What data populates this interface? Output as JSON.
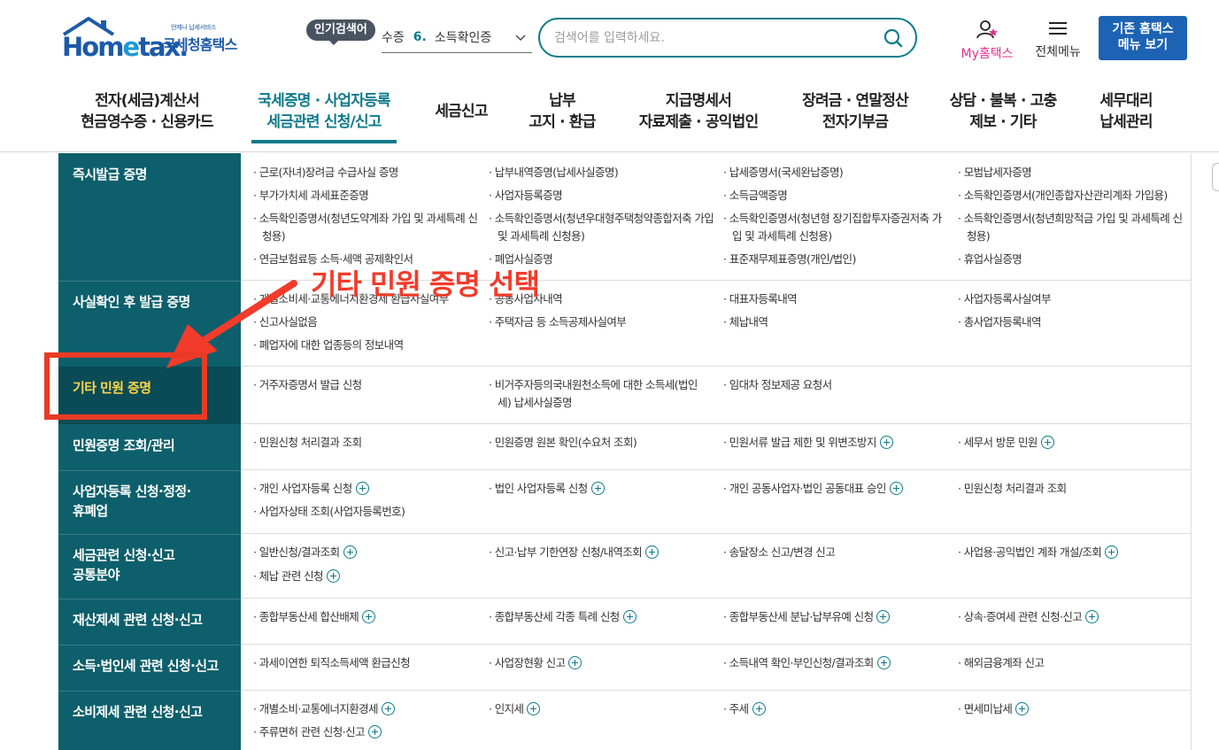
{
  "header": {
    "logo": {
      "sub": "언제나 납세서비스",
      "brand_a": "Hom",
      "brand_e": "e",
      "brand_b": "tax.",
      "name": "국세청홈택스"
    },
    "popular": {
      "badge": "인기검색어",
      "word1": "수증",
      "rank": "6.",
      "word2": "소득확인증"
    },
    "search": {
      "placeholder": "검색어를 입력하세요."
    },
    "my_label": "My홈택스",
    "allmenu_label": "전체메뉴",
    "legacy_btn": {
      "line1": "기존 홈택스",
      "line2": "메뉴 보기"
    }
  },
  "gnb": [
    {
      "l1": "전자(세금)계산서",
      "l2": "현금영수증 · 신용카드"
    },
    {
      "l1": "국세증명 · 사업자등록",
      "l2": "세금관련 신청/신고"
    },
    {
      "l1": "세금신고",
      "l2": ""
    },
    {
      "l1": "납부",
      "l2": "고지 · 환급"
    },
    {
      "l1": "지급명세서",
      "l2": "자료제출 · 공익법인"
    },
    {
      "l1": "장려금 · 연말정산",
      "l2": "전자기부금"
    },
    {
      "l1": "상담 · 불복 · 고충",
      "l2": "제보 · 기타"
    },
    {
      "l1": "세무대리",
      "l2": "납세관리"
    }
  ],
  "categories": [
    {
      "l1": "즉시발급 증명",
      "l2": ""
    },
    {
      "l1": "사실확인 후 발급 증명",
      "l2": ""
    },
    {
      "l1": "기타 민원 증명",
      "l2": ""
    },
    {
      "l1": "민원증명 조회/관리",
      "l2": ""
    },
    {
      "l1": "사업자등록 신청·정정·",
      "l2": "휴폐업"
    },
    {
      "l1": "세금관련 신청·신고",
      "l2": "공통분야"
    },
    {
      "l1": "재산제세 관련 신청·신고",
      "l2": ""
    },
    {
      "l1": "소득·법인세 관련 신청·신고",
      "l2": ""
    },
    {
      "l1": "소비제세 관련 신청·신고",
      "l2": ""
    }
  ],
  "items": {
    "r0": [
      "근로(자녀)장려금 수급사실 증명",
      "납부내역증명(납세사실증명)",
      "납세증명서(국세완납증명)",
      "모범납세자증명",
      "부가가치세 과세표준증명",
      "사업자등록증명",
      "소득금액증명",
      "소득확인증명서(개인종합자산관리계좌 가입용)",
      "소득확인증명서(청년도약계좌 가입 및 과세특례 신청용)",
      "소득확인증명서(청년우대형주택청약종합저축 가입 및 과세특례 신청용)",
      "소득확인증명서(청년형 장기집합투자증권저축 가입 및 과세특례 신청용)",
      "소득확인증명서(청년희망적금 가입 및 과세특례 신청용)",
      "연금보험료등 소득·세액 공제확인서",
      "폐업사실증명",
      "표준재무제표증명(개인/법인)",
      "휴업사실증명"
    ],
    "r1": [
      "개별소비세·교통에너지환경세 환급사실여부",
      "공동사업자내역",
      "대표자등록내역",
      "사업자등록사실여부",
      "신고사실없음",
      "주택자금 등 소득공제사실여부",
      "체납내역",
      "총사업자등록내역",
      "폐업자에 대한 업종등의 정보내역"
    ],
    "r2": [
      "거주자증명서 발급 신청",
      "비거주자등의국내원천소득에 대한 소득세(법인세) 납세사실증명",
      "임대차 정보제공 요청서"
    ],
    "r3": [
      "민원신청 처리결과 조회",
      "민원증명 원본 확인(수요처 조회)",
      "민원서류 발급 제한 및 위변조방지",
      "세무서 방문 민원"
    ],
    "r4": [
      "개인 사업자등록 신청",
      "법인 사업자등록 신청",
      "개인 공동사업자·법인 공동대표 승인",
      "민원신청 처리결과 조회",
      "사업자상태 조회(사업자등록번호)"
    ],
    "r5": [
      "일반신청/결과조회",
      "신고·납부 기한연장 신청/내역조회",
      "송달장소 신고/변경 신고",
      "사업용·공익법인 계좌 개설/조회",
      "체납 관련 신청"
    ],
    "r6": [
      "종합부동산세 합산배제",
      "종합부동산세 각종 특례 신청",
      "종합부동산세 분납·납부유예 신청",
      "상속·증여세 관련 신청·신고"
    ],
    "r7": [
      "과세이연한 퇴직소득세액 환급신청",
      "사업장현황 신고",
      "소득내역 확인·부인신청/결과조회",
      "해외금융계좌 신고"
    ],
    "r8": [
      "개별소비·교통에너지환경세",
      "인지세",
      "주세",
      "면세미납세",
      "주류면허 관련 신청·신고"
    ]
  },
  "annotation": {
    "text": "기타 민원 증명 선택"
  },
  "colors": {
    "teal": "#0d5f6b",
    "teal_dark": "#0a4b55",
    "accent": "#0c7a8c",
    "highlight": "#ffd64a",
    "annotation_red": "#ea3a25",
    "brand_blue": "#1c5aa9"
  }
}
